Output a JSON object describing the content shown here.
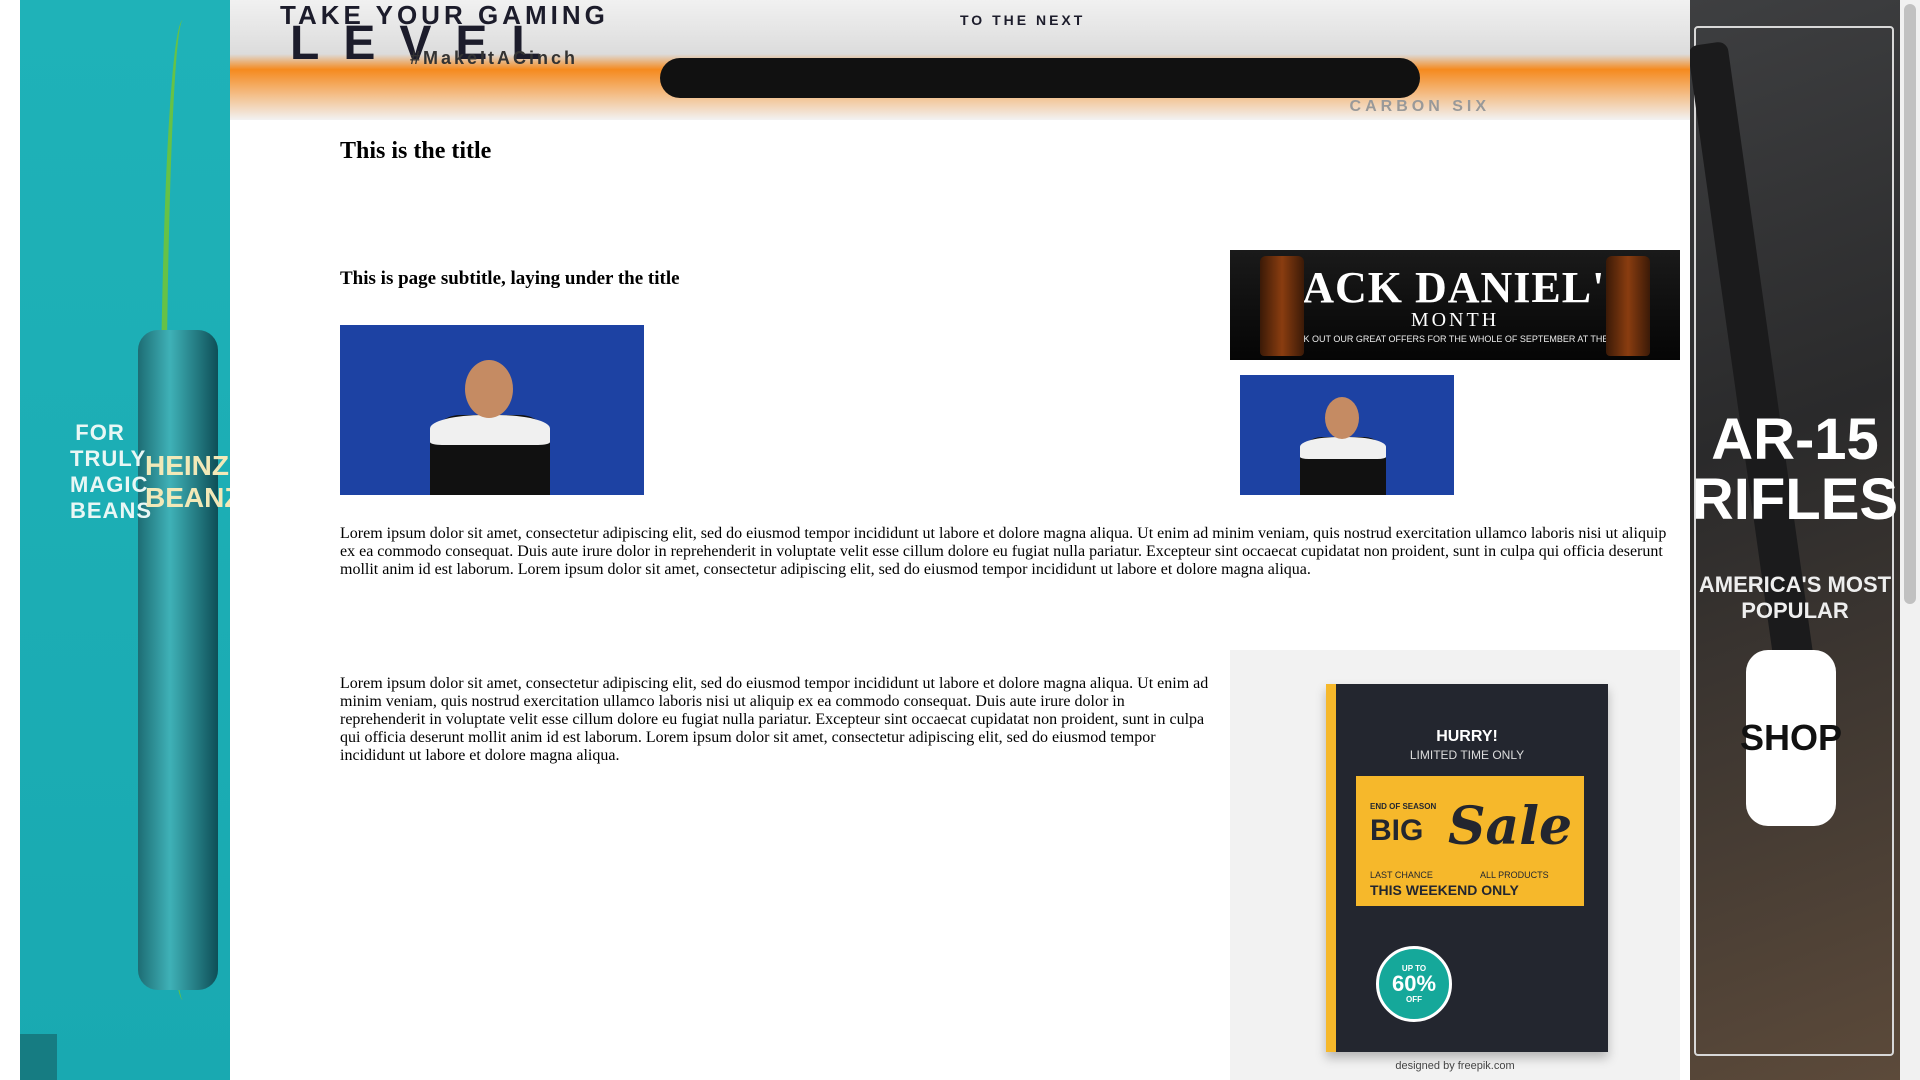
{
  "page": {
    "title": "This is the title",
    "subtitle": "This is page subtitle, laying under the title",
    "paragraph_1": "Lorem ipsum dolor sit amet, consectetur adipiscing elit, sed do eiusmod tempor incididunt ut labore et dolore magna aliqua. Ut enim ad minim veniam, quis nostrud exercitation ullamco laboris nisi ut aliquip ex ea commodo consequat. Duis aute irure dolor in reprehenderit in voluptate velit esse cillum dolore eu fugiat nulla pariatur. Excepteur sint occaecat cupidatat non proident, sunt in culpa qui officia deserunt mollit anim id est laborum. Lorem ipsum dolor sit amet, consectetur adipiscing elit, sed do eiusmod tempor incididunt ut labore et dolore magna aliqua.",
    "paragraph_2": "Lorem ipsum dolor sit amet, consectetur adipiscing elit, sed do eiusmod tempor incididunt ut labore et dolore magna aliqua. Ut enim ad minim veniam, quis nostrud exercitation ullamco laboris nisi ut aliquip ex ea commodo consequat. Duis aute irure dolor in reprehenderit in voluptate velit esse cillum dolore eu fugiat nulla pariatur. Excepteur sint occaecat cupidatat non proident, sunt in culpa qui officia deserunt mollit anim id est laborum. Lorem ipsum dolor sit amet, consectetur adipiscing elit, sed do eiusmod tempor incididunt ut labore et dolore magna aliqua."
  },
  "ads": {
    "top_banner": {
      "headline": "TAKE YOUR GAMING",
      "big": "LEVEL",
      "small": "TO THE NEXT",
      "hashtag": "#MakeItACinch",
      "sub": "CARBON SIX"
    },
    "left_skyscraper": {
      "slogan": "FOR TRULY MAGIC BEANS",
      "brand": "HEINZ BEANZ"
    },
    "right_skyscraper": {
      "title": "AR-15 RIFLES",
      "subtitle": "AMERICA'S MOST POPULAR",
      "cta": "SHOP"
    },
    "jack_daniels": {
      "brand": "JACK DANIEL'S",
      "month": "MONTH",
      "small": "CHECK OUT OUR GREAT OFFERS FOR THE WHOLE OF SEPTEMBER AT THE BAR!"
    },
    "sale": {
      "hurry": "HURRY!",
      "limited": "LIMITED TIME ONLY",
      "end_of_season": "END OF SEASON",
      "big": "BIG",
      "sale": "Sale",
      "last_chance": "LAST CHANCE",
      "all_products": "ALL PRODUCTS",
      "weekend": "THIS WEEKEND ONLY",
      "badge_up_to": "UP TO",
      "badge_percent": "60%",
      "badge_off": "OFF",
      "credit": "designed by freepik.com"
    }
  },
  "colors": {
    "left_ad_bg": "#1fb2b8",
    "top_ad_orange": "#f58a1e",
    "sale_yellow": "#f6b82b",
    "sale_dark": "#23262f",
    "photo_blue": "#1d42a3"
  }
}
